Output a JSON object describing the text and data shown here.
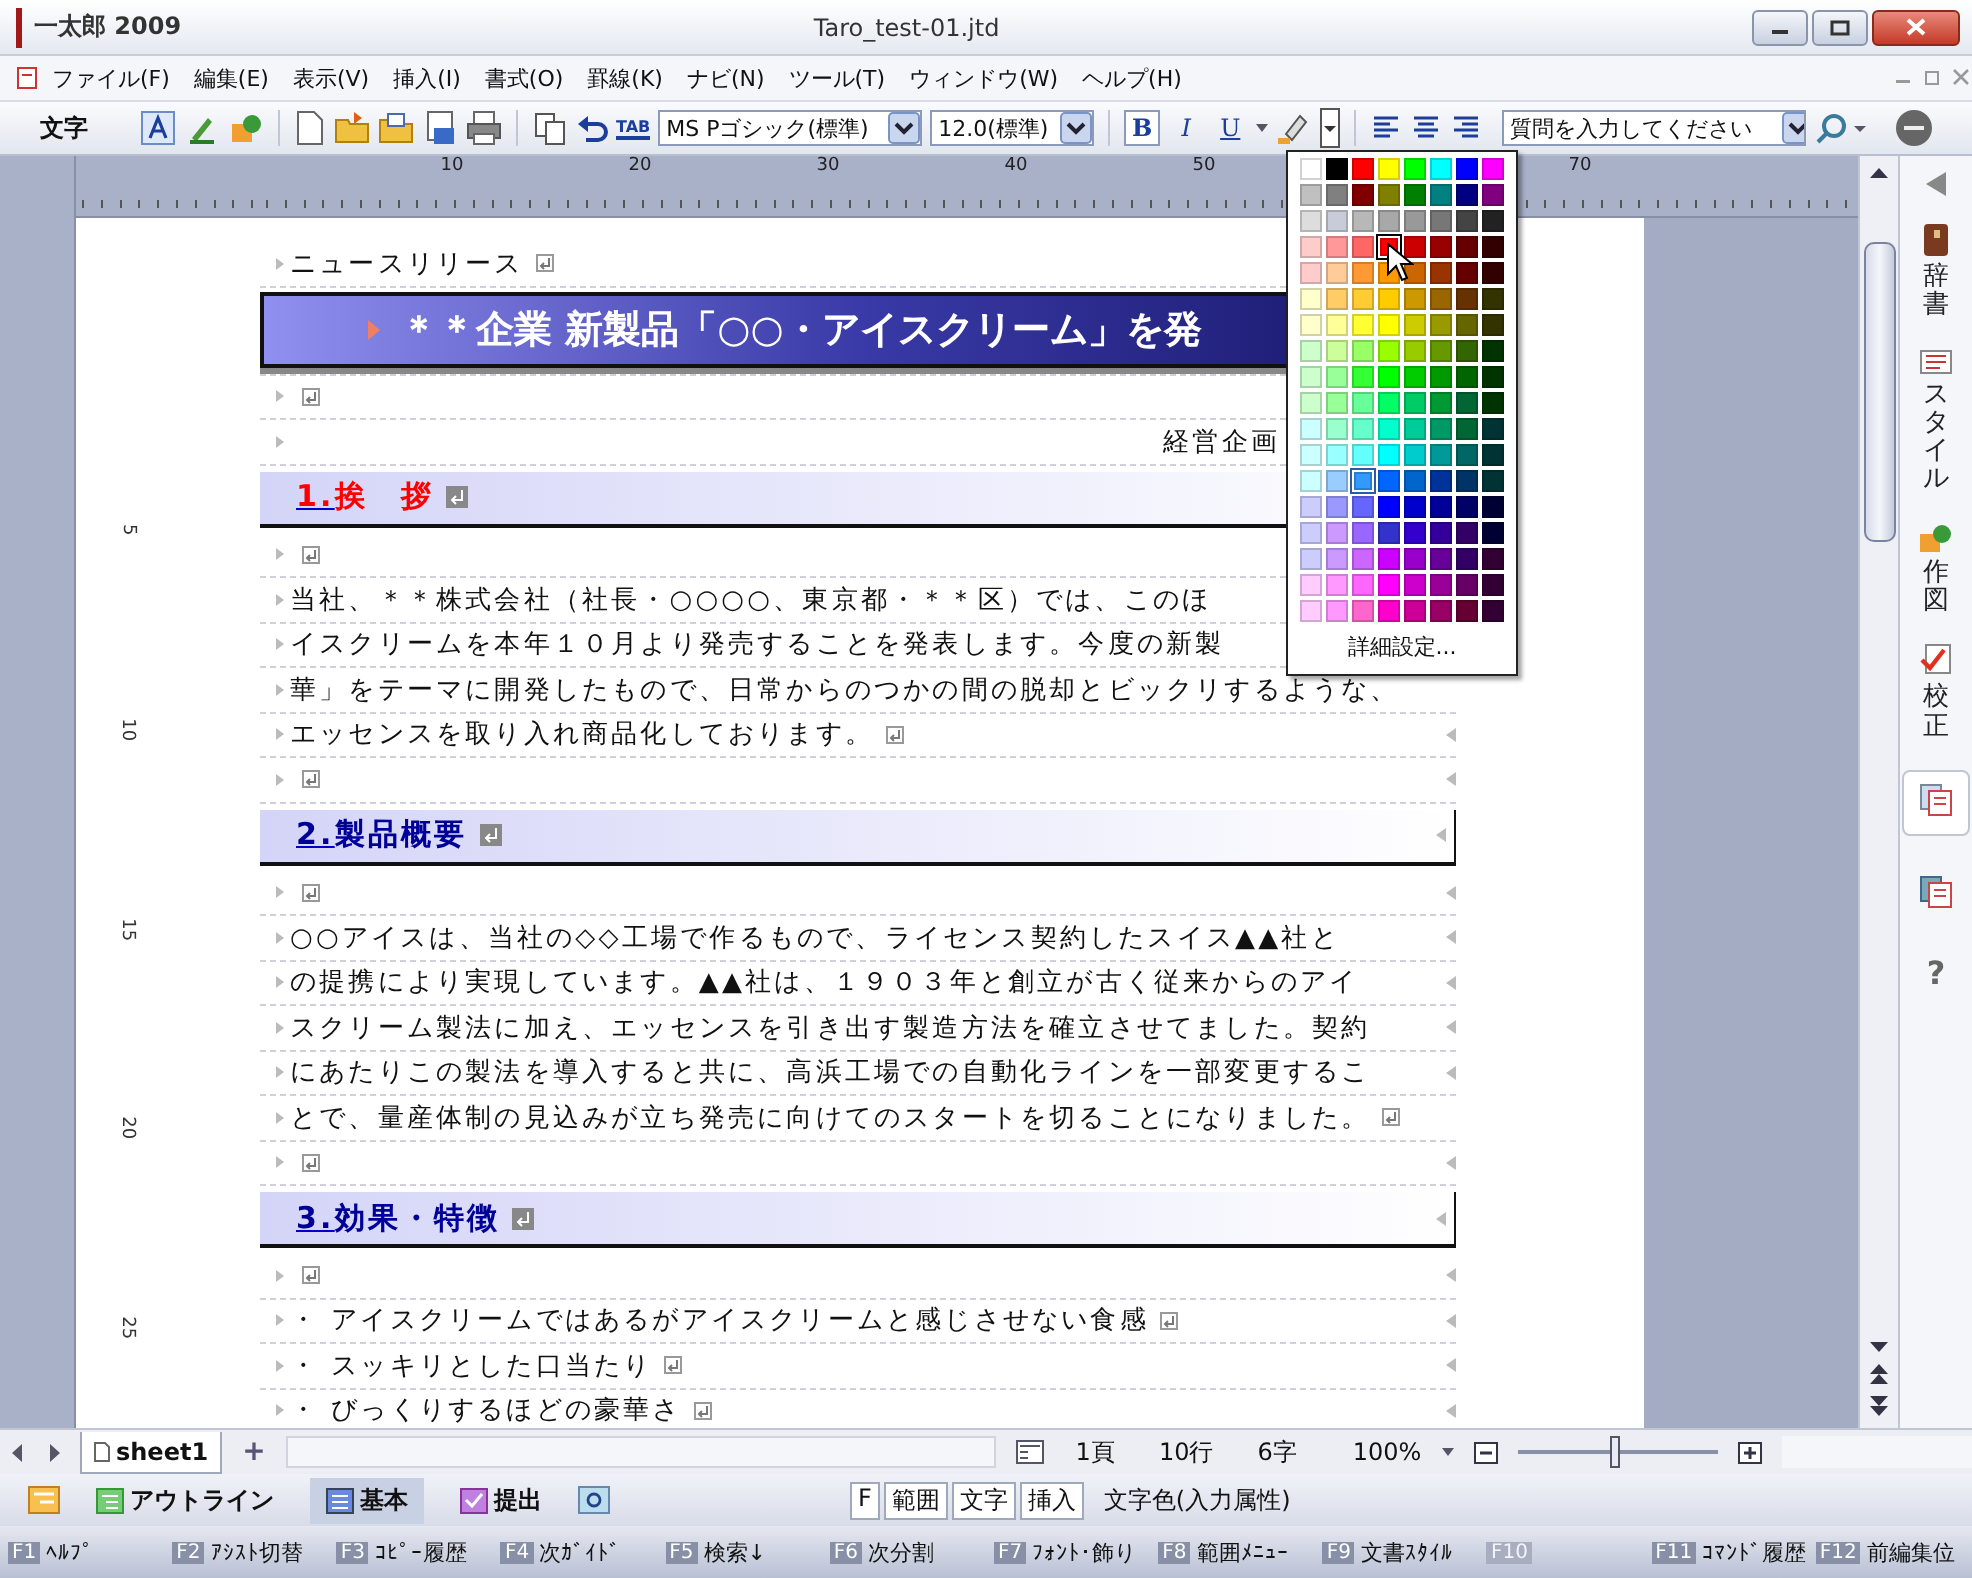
{
  "window": {
    "app_name": "一太郎 2009",
    "title": "Taro_test-01.jtd"
  },
  "menu": [
    "ファイル(F)",
    "編集(E)",
    "表示(V)",
    "挿入(I)",
    "書式(O)",
    "罫線(K)",
    "ナビ(N)",
    "ツール(T)",
    "ウィンドウ(W)",
    "ヘルプ(H)"
  ],
  "toolbar": {
    "label": "文字",
    "tab_text": "TAB",
    "font": "MS Pゴシック(標準)",
    "size": "12.0(標準)",
    "bold": "B",
    "italic": "I",
    "underline": "U",
    "question_placeholder": "質問を入力してください"
  },
  "ruler": {
    "marks": [
      "10",
      "20",
      "30",
      "40",
      "50",
      "70"
    ],
    "vertical_marks": [
      "5",
      "10",
      "15",
      "20",
      "25"
    ]
  },
  "document": {
    "lines": [
      {
        "kind": "text",
        "text": "ニュースリリース",
        "return_mark": true,
        "end_mark": false
      },
      {
        "kind": "title",
        "text": "＊＊企業 新製品「○○・アイスクリーム」を発"
      },
      {
        "kind": "empty",
        "return_mark": true,
        "end_mark": false
      },
      {
        "kind": "right",
        "text": "経営企画",
        "return_mark": false,
        "end_mark": false
      },
      {
        "kind": "heading",
        "number": "1.",
        "text": "挨　拶",
        "color": "#ff0000",
        "return_mark": true,
        "end_mark": false
      },
      {
        "kind": "empty",
        "return_mark": true,
        "end_mark": false
      },
      {
        "kind": "text",
        "text": "当社、＊＊株式会社（社長・○○○○、東京都・＊＊区）では、このほ",
        "return_mark": false,
        "end_mark": false
      },
      {
        "kind": "text",
        "text": "イスクリームを本年１０月より発売することを発表します。今度の新製",
        "return_mark": false,
        "end_mark": false
      },
      {
        "kind": "text",
        "text": "華」をテーマに開発したもので、日常からのつかの間の脱却とビックリするような、",
        "return_mark": false,
        "end_mark": false
      },
      {
        "kind": "text",
        "text": "エッセンスを取り入れ商品化しております。",
        "return_mark": true,
        "end_mark": true
      },
      {
        "kind": "empty",
        "return_mark": true,
        "end_mark": true
      },
      {
        "kind": "heading",
        "number": "2.",
        "text": "製品概要",
        "color": "#000099",
        "return_mark": true,
        "end_mark": true
      },
      {
        "kind": "empty",
        "return_mark": true,
        "end_mark": true
      },
      {
        "kind": "text",
        "text": "○○アイスは、当社の◇◇工場で作るもので、ライセンス契約したスイス▲▲社と",
        "return_mark": false,
        "end_mark": true
      },
      {
        "kind": "text",
        "text": "の提携により実現しています。▲▲社は、１９０３年と創立が古く従来からのアイ",
        "return_mark": false,
        "end_mark": true
      },
      {
        "kind": "text",
        "text": "スクリーム製法に加え、エッセンスを引き出す製造方法を確立させてました。契約",
        "return_mark": false,
        "end_mark": true
      },
      {
        "kind": "text",
        "text": "にあたりこの製法を導入すると共に、高浜工場での自動化ラインを一部変更するこ",
        "return_mark": false,
        "end_mark": true
      },
      {
        "kind": "text",
        "text": "とで、量産体制の見込みが立ち発売に向けてのスタートを切ることになりました。",
        "return_mark": true,
        "end_mark": false
      },
      {
        "kind": "empty",
        "return_mark": true,
        "end_mark": true
      },
      {
        "kind": "heading",
        "number": "3.",
        "text": "効果・特徴",
        "color": "#000099",
        "return_mark": true,
        "end_mark": true
      },
      {
        "kind": "empty",
        "return_mark": true,
        "end_mark": true
      },
      {
        "kind": "bullet",
        "mark": "・",
        "text": "アイスクリームではあるがアイスクリームと感じさせない食感",
        "return_mark": true,
        "end_mark": true
      },
      {
        "kind": "bullet",
        "mark": "・",
        "text": "スッキリとした口当たり",
        "return_mark": true,
        "end_mark": true
      },
      {
        "kind": "bullet",
        "mark": "・",
        "text": "びっくりするほどの豪華さ",
        "return_mark": true,
        "end_mark": true
      }
    ]
  },
  "color_palette": {
    "more_label": "詳細設定...",
    "swatches": [
      [
        {
          "color": "#ffffff",
          "selected": false,
          "hovered": false
        },
        {
          "color": "#000000",
          "selected": false,
          "hovered": false
        },
        {
          "color": "#ff0000",
          "selected": false,
          "hovered": false
        },
        {
          "color": "#ffff00",
          "selected": false,
          "hovered": false
        },
        {
          "color": "#00ff00",
          "selected": false,
          "hovered": false
        },
        {
          "color": "#00ffff",
          "selected": false,
          "hovered": false
        },
        {
          "color": "#0000ff",
          "selected": false,
          "hovered": false
        },
        {
          "color": "#ff00ff",
          "selected": false,
          "hovered": false
        }
      ],
      [
        {
          "color": "#c0c0c0",
          "selected": false,
          "hovered": false
        },
        {
          "color": "#808080",
          "selected": false,
          "hovered": false
        },
        {
          "color": "#800000",
          "selected": false,
          "hovered": false
        },
        {
          "color": "#808000",
          "selected": false,
          "hovered": false
        },
        {
          "color": "#008000",
          "selected": false,
          "hovered": false
        },
        {
          "color": "#008080",
          "selected": false,
          "hovered": false
        },
        {
          "color": "#000080",
          "selected": false,
          "hovered": false
        },
        {
          "color": "#800080",
          "selected": false,
          "hovered": false
        }
      ],
      [
        {
          "color": "#dddddd",
          "selected": false,
          "hovered": false
        },
        {
          "color": "#c8ccd8",
          "selected": false,
          "hovered": false
        },
        {
          "color": "#b8b8b8",
          "selected": false,
          "hovered": false
        },
        {
          "color": "#a8a8a8",
          "selected": false,
          "hovered": false
        },
        {
          "color": "#999999",
          "selected": false,
          "hovered": false
        },
        {
          "color": "#777777",
          "selected": false,
          "hovered": false
        },
        {
          "color": "#444444",
          "selected": false,
          "hovered": false
        },
        {
          "color": "#222222",
          "selected": false,
          "hovered": false
        }
      ],
      [
        {
          "color": "#ffcccc",
          "selected": false,
          "hovered": false
        },
        {
          "color": "#ff9999",
          "selected": false,
          "hovered": false
        },
        {
          "color": "#ff6666",
          "selected": false,
          "hovered": false
        },
        {
          "color": "#ff0000",
          "selected": false,
          "hovered": true
        },
        {
          "color": "#cc0000",
          "selected": false,
          "hovered": false
        },
        {
          "color": "#990000",
          "selected": false,
          "hovered": false
        },
        {
          "color": "#660000",
          "selected": false,
          "hovered": false
        },
        {
          "color": "#330000",
          "selected": false,
          "hovered": false
        }
      ],
      [
        {
          "color": "#ffcccc",
          "selected": false,
          "hovered": false
        },
        {
          "color": "#ffcc99",
          "selected": false,
          "hovered": false
        },
        {
          "color": "#ff9933",
          "selected": false,
          "hovered": false
        },
        {
          "color": "#ff9900",
          "selected": false,
          "hovered": false
        },
        {
          "color": "#cc6600",
          "selected": false,
          "hovered": false
        },
        {
          "color": "#993300",
          "selected": false,
          "hovered": false
        },
        {
          "color": "#660000",
          "selected": false,
          "hovered": false
        },
        {
          "color": "#330000",
          "selected": false,
          "hovered": false
        }
      ],
      [
        {
          "color": "#ffffcc",
          "selected": false,
          "hovered": false
        },
        {
          "color": "#ffcc66",
          "selected": false,
          "hovered": false
        },
        {
          "color": "#ffcc33",
          "selected": false,
          "hovered": false
        },
        {
          "color": "#ffcc00",
          "selected": false,
          "hovered": false
        },
        {
          "color": "#cc9900",
          "selected": false,
          "hovered": false
        },
        {
          "color": "#996600",
          "selected": false,
          "hovered": false
        },
        {
          "color": "#663300",
          "selected": false,
          "hovered": false
        },
        {
          "color": "#333300",
          "selected": false,
          "hovered": false
        }
      ],
      [
        {
          "color": "#ffffcc",
          "selected": false,
          "hovered": false
        },
        {
          "color": "#ffff99",
          "selected": false,
          "hovered": false
        },
        {
          "color": "#ffff33",
          "selected": false,
          "hovered": false
        },
        {
          "color": "#ffff00",
          "selected": false,
          "hovered": false
        },
        {
          "color": "#cccc00",
          "selected": false,
          "hovered": false
        },
        {
          "color": "#999900",
          "selected": false,
          "hovered": false
        },
        {
          "color": "#666600",
          "selected": false,
          "hovered": false
        },
        {
          "color": "#333300",
          "selected": false,
          "hovered": false
        }
      ],
      [
        {
          "color": "#ccffcc",
          "selected": false,
          "hovered": false
        },
        {
          "color": "#ccff99",
          "selected": false,
          "hovered": false
        },
        {
          "color": "#99ff66",
          "selected": false,
          "hovered": false
        },
        {
          "color": "#99ff00",
          "selected": false,
          "hovered": false
        },
        {
          "color": "#99cc00",
          "selected": false,
          "hovered": false
        },
        {
          "color": "#669900",
          "selected": false,
          "hovered": false
        },
        {
          "color": "#336600",
          "selected": false,
          "hovered": false
        },
        {
          "color": "#003300",
          "selected": false,
          "hovered": false
        }
      ],
      [
        {
          "color": "#ccffcc",
          "selected": false,
          "hovered": false
        },
        {
          "color": "#99ff99",
          "selected": false,
          "hovered": false
        },
        {
          "color": "#33ff33",
          "selected": false,
          "hovered": false
        },
        {
          "color": "#00ff00",
          "selected": false,
          "hovered": false
        },
        {
          "color": "#00cc00",
          "selected": false,
          "hovered": false
        },
        {
          "color": "#009900",
          "selected": false,
          "hovered": false
        },
        {
          "color": "#006600",
          "selected": false,
          "hovered": false
        },
        {
          "color": "#003300",
          "selected": false,
          "hovered": false
        }
      ],
      [
        {
          "color": "#ccffcc",
          "selected": false,
          "hovered": false
        },
        {
          "color": "#99ff99",
          "selected": false,
          "hovered": false
        },
        {
          "color": "#66ff99",
          "selected": false,
          "hovered": false
        },
        {
          "color": "#00ff66",
          "selected": false,
          "hovered": false
        },
        {
          "color": "#00cc66",
          "selected": false,
          "hovered": false
        },
        {
          "color": "#009933",
          "selected": false,
          "hovered": false
        },
        {
          "color": "#006633",
          "selected": false,
          "hovered": false
        },
        {
          "color": "#003300",
          "selected": false,
          "hovered": false
        }
      ],
      [
        {
          "color": "#ccffff",
          "selected": false,
          "hovered": false
        },
        {
          "color": "#99ffcc",
          "selected": false,
          "hovered": false
        },
        {
          "color": "#66ffcc",
          "selected": false,
          "hovered": false
        },
        {
          "color": "#00ffcc",
          "selected": false,
          "hovered": false
        },
        {
          "color": "#00cc99",
          "selected": false,
          "hovered": false
        },
        {
          "color": "#009966",
          "selected": false,
          "hovered": false
        },
        {
          "color": "#006633",
          "selected": false,
          "hovered": false
        },
        {
          "color": "#003333",
          "selected": false,
          "hovered": false
        }
      ],
      [
        {
          "color": "#ccffff",
          "selected": false,
          "hovered": false
        },
        {
          "color": "#99ffff",
          "selected": false,
          "hovered": false
        },
        {
          "color": "#66ffff",
          "selected": false,
          "hovered": false
        },
        {
          "color": "#00ffff",
          "selected": false,
          "hovered": false
        },
        {
          "color": "#00cccc",
          "selected": false,
          "hovered": false
        },
        {
          "color": "#009999",
          "selected": false,
          "hovered": false
        },
        {
          "color": "#006666",
          "selected": false,
          "hovered": false
        },
        {
          "color": "#003333",
          "selected": false,
          "hovered": false
        }
      ],
      [
        {
          "color": "#ccffff",
          "selected": false,
          "hovered": false
        },
        {
          "color": "#99ccff",
          "selected": false,
          "hovered": false
        },
        {
          "color": "#3399ff",
          "selected": true,
          "hovered": false
        },
        {
          "color": "#0066ff",
          "selected": false,
          "hovered": false
        },
        {
          "color": "#0066cc",
          "selected": false,
          "hovered": false
        },
        {
          "color": "#003399",
          "selected": false,
          "hovered": false
        },
        {
          "color": "#003366",
          "selected": false,
          "hovered": false
        },
        {
          "color": "#003333",
          "selected": false,
          "hovered": false
        }
      ],
      [
        {
          "color": "#ccccff",
          "selected": false,
          "hovered": false
        },
        {
          "color": "#9999ff",
          "selected": false,
          "hovered": false
        },
        {
          "color": "#6666ff",
          "selected": false,
          "hovered": false
        },
        {
          "color": "#0000ff",
          "selected": false,
          "hovered": false
        },
        {
          "color": "#0000cc",
          "selected": false,
          "hovered": false
        },
        {
          "color": "#000099",
          "selected": false,
          "hovered": false
        },
        {
          "color": "#000066",
          "selected": false,
          "hovered": false
        },
        {
          "color": "#000033",
          "selected": false,
          "hovered": false
        }
      ],
      [
        {
          "color": "#ccccff",
          "selected": false,
          "hovered": false
        },
        {
          "color": "#cc99ff",
          "selected": false,
          "hovered": false
        },
        {
          "color": "#9966ff",
          "selected": false,
          "hovered": false
        },
        {
          "color": "#3333cc",
          "selected": false,
          "hovered": false
        },
        {
          "color": "#3300cc",
          "selected": false,
          "hovered": false
        },
        {
          "color": "#330099",
          "selected": false,
          "hovered": false
        },
        {
          "color": "#330066",
          "selected": false,
          "hovered": false
        },
        {
          "color": "#000033",
          "selected": false,
          "hovered": false
        }
      ],
      [
        {
          "color": "#ccccff",
          "selected": false,
          "hovered": false
        },
        {
          "color": "#cc99ff",
          "selected": false,
          "hovered": false
        },
        {
          "color": "#cc66ff",
          "selected": false,
          "hovered": false
        },
        {
          "color": "#cc00ff",
          "selected": false,
          "hovered": false
        },
        {
          "color": "#9900cc",
          "selected": false,
          "hovered": false
        },
        {
          "color": "#660099",
          "selected": false,
          "hovered": false
        },
        {
          "color": "#330066",
          "selected": false,
          "hovered": false
        },
        {
          "color": "#330033",
          "selected": false,
          "hovered": false
        }
      ],
      [
        {
          "color": "#ffccff",
          "selected": false,
          "hovered": false
        },
        {
          "color": "#ff99ff",
          "selected": false,
          "hovered": false
        },
        {
          "color": "#ff66ff",
          "selected": false,
          "hovered": false
        },
        {
          "color": "#ff00ff",
          "selected": false,
          "hovered": false
        },
        {
          "color": "#cc00cc",
          "selected": false,
          "hovered": false
        },
        {
          "color": "#990099",
          "selected": false,
          "hovered": false
        },
        {
          "color": "#660066",
          "selected": false,
          "hovered": false
        },
        {
          "color": "#330033",
          "selected": false,
          "hovered": false
        }
      ],
      [
        {
          "color": "#ffccff",
          "selected": false,
          "hovered": false
        },
        {
          "color": "#ff99ff",
          "selected": false,
          "hovered": false
        },
        {
          "color": "#ff66cc",
          "selected": false,
          "hovered": false
        },
        {
          "color": "#ff00cc",
          "selected": false,
          "hovered": false
        },
        {
          "color": "#cc0099",
          "selected": false,
          "hovered": false
        },
        {
          "color": "#990066",
          "selected": false,
          "hovered": false
        },
        {
          "color": "#660033",
          "selected": false,
          "hovered": false
        },
        {
          "color": "#330033",
          "selected": false,
          "hovered": false
        }
      ]
    ]
  },
  "side_panel": {
    "tabs": [
      {
        "label": "辞書"
      },
      {
        "label": "スタイル"
      },
      {
        "label": "作図"
      },
      {
        "label": "校正"
      }
    ],
    "help": "?"
  },
  "sheet_tabs": [
    {
      "label": "sheet1",
      "selected": true
    }
  ],
  "add_sheet": "+",
  "status": {
    "page": "1頁",
    "line": "10行",
    "char": "6字",
    "zoom": "100%"
  },
  "zoom_slider": {
    "level": 0.48
  },
  "modes": [
    {
      "label": "アウトライン",
      "selected": false
    },
    {
      "label": "基本",
      "selected": true
    },
    {
      "label": "提出",
      "selected": false
    }
  ],
  "input_keys": [
    "F",
    "範囲",
    "文字",
    "挿入"
  ],
  "input_status": "文字色(入力属性)",
  "function_keys": [
    {
      "key": "F1",
      "label": "ﾍﾙﾌﾟ",
      "disabled": false
    },
    {
      "key": "F2",
      "label": "ｱｼｽﾄ切替",
      "disabled": false
    },
    {
      "key": "F3",
      "label": "ｺﾋﾟｰ履歴",
      "disabled": false
    },
    {
      "key": "F4",
      "label": "次ｶﾞｲﾄﾞ",
      "disabled": false
    },
    {
      "key": "F5",
      "label": "検索↓",
      "disabled": false
    },
    {
      "key": "F6",
      "label": "次分割",
      "disabled": false
    },
    {
      "key": "F7",
      "label": "ﾌｫﾝﾄ･飾り",
      "disabled": false
    },
    {
      "key": "F8",
      "label": "範囲ﾒﾆｭｰ",
      "disabled": false
    },
    {
      "key": "F9",
      "label": "文書ｽﾀｲﾙ",
      "disabled": false
    },
    {
      "key": "F10",
      "disabled": true
    },
    {
      "key": "F11",
      "label": "ｺﾏﾝﾄﾞ履歴",
      "disabled": false
    },
    {
      "key": "F12",
      "label": "前編集位",
      "disabled": false
    }
  ]
}
